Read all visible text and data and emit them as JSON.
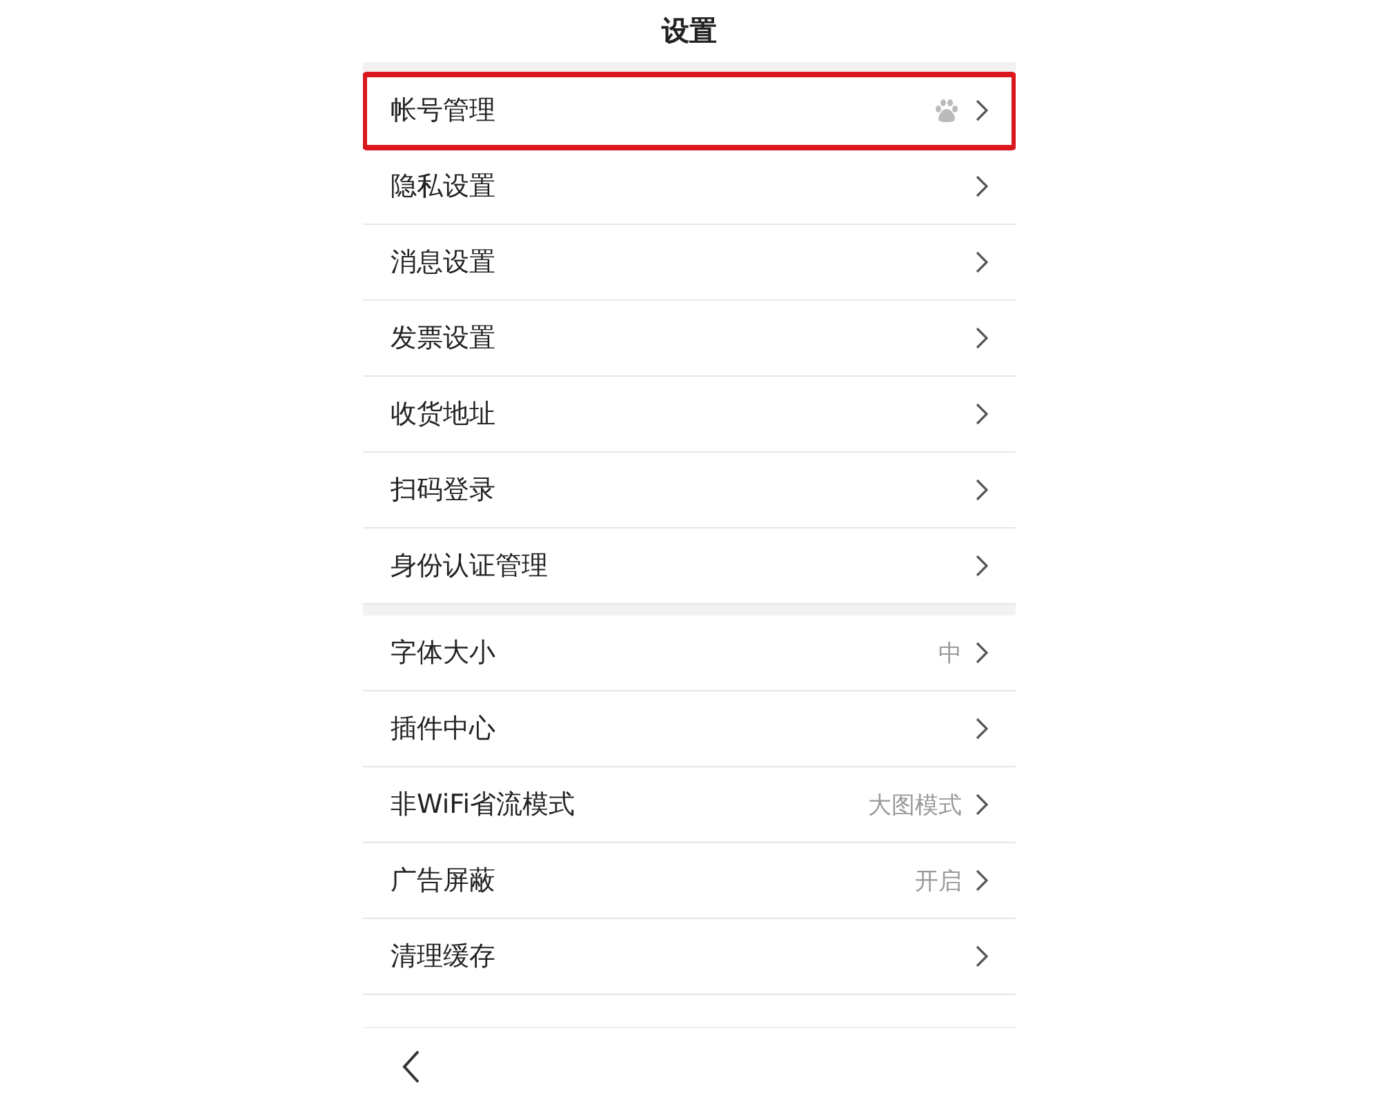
{
  "title": "设置",
  "groups": [
    {
      "items": [
        {
          "label": "帐号管理",
          "highlighted": true,
          "badge_icon": true
        },
        {
          "label": "隐私设置",
          "highlighted": false,
          "badge_icon": false
        },
        {
          "label": "消息设置",
          "highlighted": false,
          "badge_icon": false
        },
        {
          "label": "发票设置",
          "highlighted": false,
          "badge_icon": false
        },
        {
          "label": "收货地址",
          "highlighted": false,
          "badge_icon": false
        },
        {
          "label": "扫码登录",
          "highlighted": false,
          "badge_icon": false
        },
        {
          "label": "身份认证管理",
          "highlighted": false,
          "badge_icon": false
        }
      ]
    },
    {
      "items": [
        {
          "label": "字体大小",
          "value": "中",
          "highlighted": false,
          "badge_icon": false
        },
        {
          "label": "插件中心",
          "highlighted": false,
          "badge_icon": false
        },
        {
          "label": "非WiFi省流模式",
          "value": "大图模式",
          "highlighted": false,
          "badge_icon": false
        },
        {
          "label": "广告屏蔽",
          "value": "开启",
          "highlighted": false,
          "badge_icon": false
        },
        {
          "label": "清理缓存",
          "highlighted": false,
          "badge_icon": false
        }
      ]
    }
  ]
}
